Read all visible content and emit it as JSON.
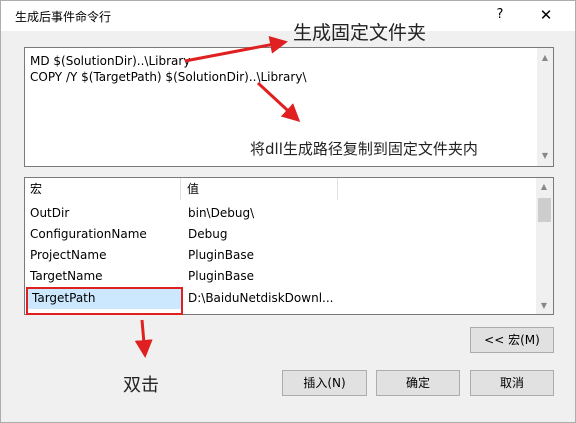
{
  "window": {
    "title": "生成后事件命令行",
    "help_label": "?",
    "close_label": "✕"
  },
  "command": {
    "lines": [
      "MD $(SolutionDir)..\\Library",
      "COPY /Y $(TargetPath) $(SolutionDir)..\\Library\\"
    ]
  },
  "macros": {
    "headers": {
      "name": "宏",
      "value": "值"
    },
    "rows": [
      {
        "name": "OutDir",
        "value": "bin\\Debug\\"
      },
      {
        "name": "ConfigurationName",
        "value": "Debug"
      },
      {
        "name": "ProjectName",
        "value": "PluginBase"
      },
      {
        "name": "TargetName",
        "value": "PluginBase"
      },
      {
        "name": "TargetPath",
        "value": "D:\\BaiduNetdiskDownl..."
      }
    ]
  },
  "buttons": {
    "macros": "<< 宏(M)",
    "insert": "插入(N)",
    "ok": "确定",
    "cancel": "取消"
  },
  "annotations": {
    "top": "生成固定文件夹",
    "middle": "将dll生成路径复制到固定文件夹内",
    "bottom": "双击"
  },
  "colors": {
    "annotation_arrow": "#e02020",
    "selection": "#cce8ff"
  }
}
